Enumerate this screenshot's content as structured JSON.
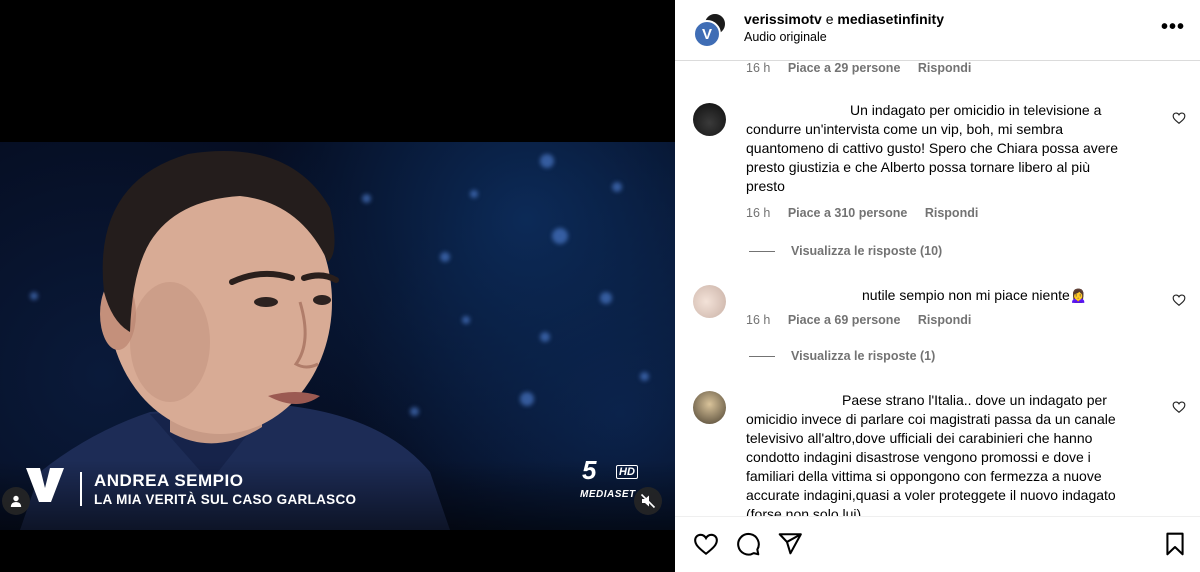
{
  "video": {
    "lower_third": {
      "name": "ANDREA SEMPIO",
      "subtitle": "LA MIA VERITÀ SUL CASO GARLASCO"
    },
    "program_logo": "V",
    "channel": {
      "number": "5",
      "hd": "HD",
      "brand": "MEDIASET"
    },
    "controls": {
      "profile_icon": "user-icon",
      "mute_icon": "speaker-muted-icon"
    }
  },
  "header": {
    "user1": "verissimotv",
    "conjunction": "e",
    "user2": "mediasetinfinity",
    "subtitle": "Audio originale",
    "avatar_letter": "V",
    "more_icon": "more-horizontal-icon"
  },
  "comments": [
    {
      "time": "16 h",
      "likes": "Piace a 29 persone",
      "reply": "Rispondi"
    },
    {
      "text": "Un indagato per omicidio in televisione a condurre un'intervista come un vip, boh, mi sembra quantomeno di cattivo gusto! Spero che Chiara possa avere presto giustizia e che Alberto possa tornare libero al più presto",
      "time": "16 h",
      "likes": "Piace a 310 persone",
      "reply": "Rispondi",
      "view_replies": "Visualizza le risposte (10)"
    },
    {
      "text": "nutile sempio non mi piace niente🙍‍♀️",
      "time": "16 h",
      "likes": "Piace a 69 persone",
      "reply": "Rispondi",
      "view_replies": "Visualizza le risposte (1)"
    },
    {
      "text": "Paese strano l'Italia.. dove un indagato per omicidio invece di parlare coi magistrati passa da un canale televisivo all'altro,dove ufficiali dei carabinieri che hanno condotto indagini disastrose vengono promossi e dove i familiari della vittima si oppongono con fermezza a nuove accurate indagini,quasi a voler proteggete il nuovo indagato (forse non solo lui)"
    }
  ],
  "actions": {
    "like": "heart-icon",
    "comment": "comment-icon",
    "share": "share-icon",
    "save": "bookmark-icon"
  },
  "colors": {
    "meta_gray": "#737373",
    "divider": "#dbdbdb",
    "studio_blue": "#0c2a57"
  }
}
